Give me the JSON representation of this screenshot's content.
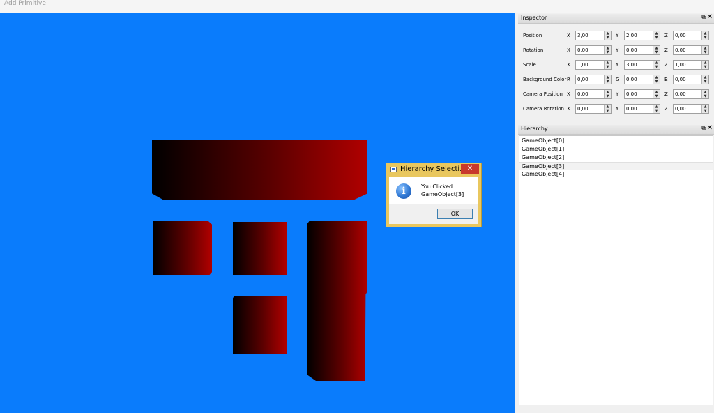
{
  "menu": {
    "add_primitive": "Add Primitive"
  },
  "viewport": {
    "background_color": "#0a7cfc",
    "object_gradient": [
      "#000000",
      "#b10000"
    ]
  },
  "dialog": {
    "title": "Hierarchy Selecti...",
    "close": "✕",
    "message_line1": "You Clicked:",
    "message_line2": "GameObject[3]",
    "ok_label": "OK",
    "icon": "info-icon"
  },
  "inspector": {
    "title": "Inspector",
    "rows": [
      {
        "label": "Position",
        "axes": [
          "X",
          "Y",
          "Z"
        ],
        "values": [
          "3,00",
          "2,00",
          "0,00"
        ]
      },
      {
        "label": "Rotation",
        "axes": [
          "X",
          "Y",
          "Z"
        ],
        "values": [
          "0,00",
          "0,00",
          "0,00"
        ]
      },
      {
        "label": "Scale",
        "axes": [
          "X",
          "Y",
          "Z"
        ],
        "values": [
          "1,00",
          "3,00",
          "1,00"
        ]
      },
      {
        "label": "Background Color",
        "axes": [
          "R",
          "G",
          "B"
        ],
        "values": [
          "0,00",
          "0,00",
          "0,00"
        ]
      },
      {
        "label": "Camera Position",
        "axes": [
          "X",
          "Y",
          "Z"
        ],
        "values": [
          "0,00",
          "0,00",
          "0,00"
        ]
      },
      {
        "label": "Camera Rotation",
        "axes": [
          "X",
          "Y",
          "Z"
        ],
        "values": [
          "0,00",
          "0,00",
          "0,00"
        ]
      }
    ]
  },
  "hierarchy": {
    "title": "Hierarchy",
    "items": [
      "GameObject[0]",
      "GameObject[1]",
      "GameObject[2]",
      "GameObject[3]",
      "GameObject[4]"
    ],
    "selected": "GameObject[3]"
  },
  "panel_icons": {
    "float": "⧉",
    "close": "✕"
  }
}
